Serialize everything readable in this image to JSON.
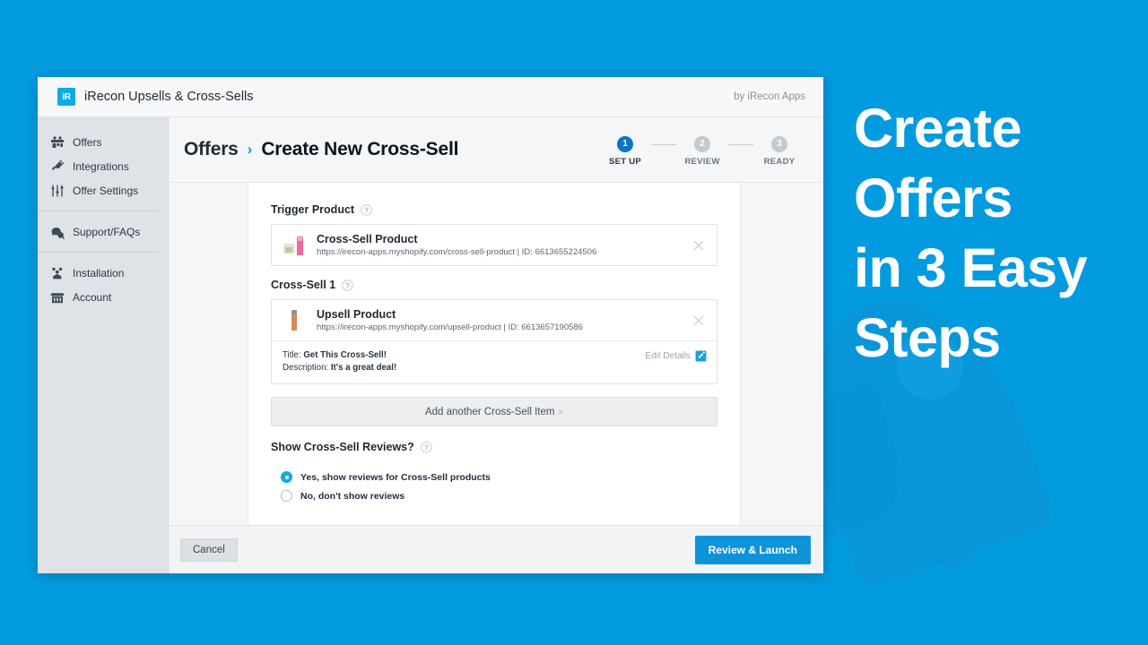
{
  "promo": {
    "lines": [
      "Create",
      "Offers",
      "in 3 Easy",
      "Steps"
    ]
  },
  "app": {
    "logo_text": "iR",
    "logo_icon": "irecon-logo-icon",
    "title": "iRecon Upsells & Cross-Sells",
    "byline": "by iRecon Apps"
  },
  "sidebar": {
    "groups": [
      {
        "items": [
          {
            "label": "Offers",
            "icon": "offers-icon"
          },
          {
            "label": "Integrations",
            "icon": "plug-icon"
          },
          {
            "label": "Offer Settings",
            "icon": "sliders-icon"
          }
        ]
      },
      {
        "items": [
          {
            "label": "Support/FAQs",
            "icon": "chat-help-icon"
          }
        ]
      },
      {
        "items": [
          {
            "label": "Installation",
            "icon": "install-icon"
          },
          {
            "label": "Account",
            "icon": "store-icon"
          }
        ]
      }
    ]
  },
  "header": {
    "breadcrumb_root": "Offers",
    "breadcrumb_separator": "›",
    "breadcrumb_current": "Create New Cross-Sell",
    "steps": [
      {
        "number": "1",
        "label": "SET UP",
        "active": true
      },
      {
        "number": "2",
        "label": "REVIEW",
        "active": false
      },
      {
        "number": "3",
        "label": "READY",
        "active": false
      }
    ],
    "accent_color": "#0b74c4"
  },
  "form": {
    "trigger_label": "Trigger Product",
    "trigger_product": {
      "name": "Cross-Sell Product",
      "meta": "https://irecon-apps.myshopify.com/cross-sell-product | ID: 6613655224506",
      "thumb": "lotion-bottle-thumbnail"
    },
    "crosssell_label": "Cross-Sell 1",
    "crosssell_product": {
      "name": "Upsell Product",
      "meta": "https://irecon-apps.myshopify.com/upsell-product | ID: 6613657190586",
      "thumb": "tube-product-thumbnail",
      "title_prefix": "Title: ",
      "title_value": "Get This Cross-Sell!",
      "description_prefix": "Description: ",
      "description_value": "It's a great deal!",
      "edit_label": "Edit Details"
    },
    "add_another_label": "Add another Cross-Sell Item",
    "add_another_chevron": "»",
    "reviews_label": "Show Cross-Sell Reviews?",
    "review_options": [
      {
        "label": "Yes, show reviews for Cross-Sell products",
        "selected": true
      },
      {
        "label": "No, don't show reviews",
        "selected": false
      }
    ]
  },
  "footer": {
    "cancel_label": "Cancel",
    "primary_label": "Review & Launch",
    "primary_color": "#0d94d8"
  },
  "colors": {
    "page_background": "#039BE0",
    "sidebar_background": "#dfe3e7",
    "brand_blue": "#0eaaea"
  }
}
